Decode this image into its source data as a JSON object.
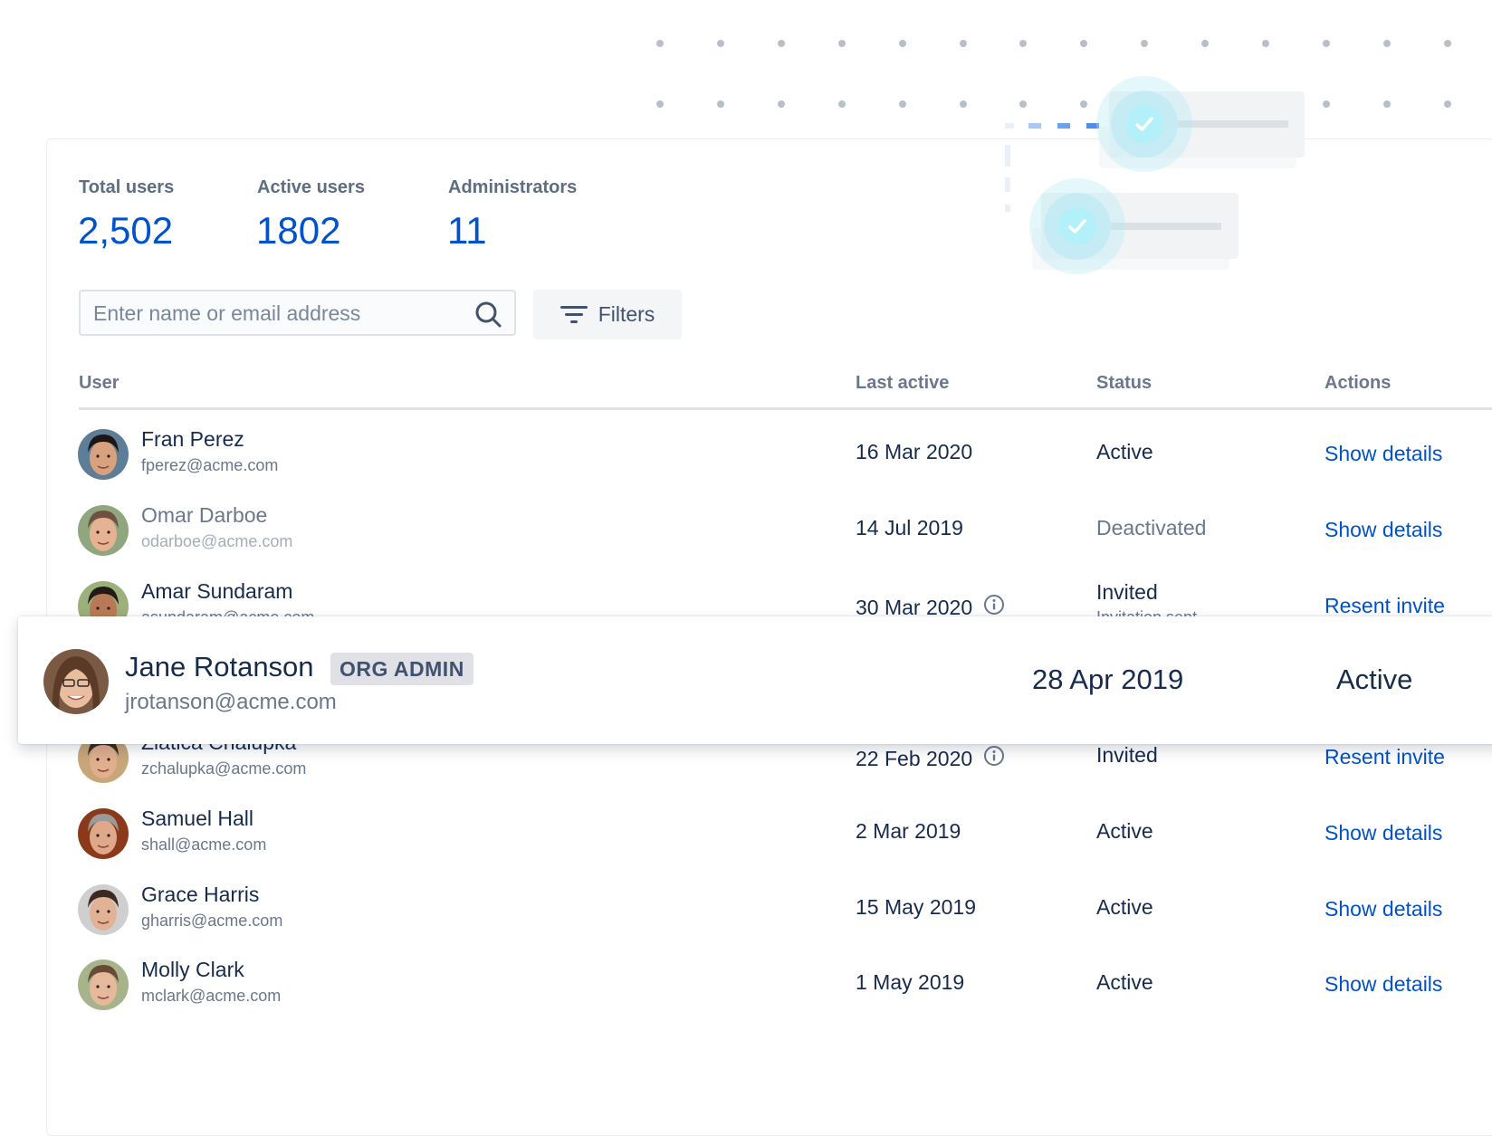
{
  "stats": [
    {
      "label": "Total users",
      "value": "2,502"
    },
    {
      "label": "Active users",
      "value": "1802"
    },
    {
      "label": "Administrators",
      "value": "11"
    }
  ],
  "search": {
    "placeholder": "Enter name or email address",
    "value": "",
    "icon": "search-icon"
  },
  "filters": {
    "label": "Filters",
    "icon": "filter-icon"
  },
  "table": {
    "headers": {
      "user": "User",
      "last_active": "Last active",
      "status": "Status",
      "actions": "Actions"
    },
    "rows": [
      {
        "name": "Fran Perez",
        "email": "fperez@acme.com",
        "last_active": "16 Mar 2020",
        "status": "Active",
        "action": "Show details",
        "info": false,
        "muted": false
      },
      {
        "name": "Omar Darboe",
        "email": "odarboe@acme.com",
        "last_active": "14 Jul 2019",
        "status": "Deactivated",
        "action": "Show details",
        "info": false,
        "muted": true
      },
      {
        "name": "Amar Sundaram",
        "email": "asundaram@acme.com",
        "last_active": "30 Mar 2020",
        "status": "Invited",
        "status_sub": "Invitation sent",
        "action": "Resent invite",
        "info": true,
        "muted": false
      },
      {
        "name": "Zlatica Chalupka",
        "email": "zchalupka@acme.com",
        "last_active": "22 Feb 2020",
        "status": "Invited",
        "action": "Resent invite",
        "info": true,
        "muted": false
      },
      {
        "name": "Samuel Hall",
        "email": "shall@acme.com",
        "last_active": "2 Mar 2019",
        "status": "Active",
        "action": "Show details",
        "info": false,
        "muted": false
      },
      {
        "name": "Grace Harris",
        "email": "gharris@acme.com",
        "last_active": "15 May 2019",
        "status": "Active",
        "action": "Show details",
        "info": false,
        "muted": false
      },
      {
        "name": "Molly Clark",
        "email": "mclark@acme.com",
        "last_active": "1 May 2019",
        "status": "Active",
        "action": "Show details",
        "info": false,
        "muted": false
      }
    ]
  },
  "highlighted_user": {
    "name": "Jane Rotanson",
    "badge": "ORG ADMIN",
    "email": "jrotanson@acme.com",
    "last_active": "28 Apr 2019",
    "status": "Active"
  },
  "colors": {
    "accent": "#0052cc",
    "text_primary": "#172b4d",
    "text_secondary": "#6b778c",
    "badge_bg": "#dfe1e6",
    "check_circle": "#b3f0fa"
  }
}
